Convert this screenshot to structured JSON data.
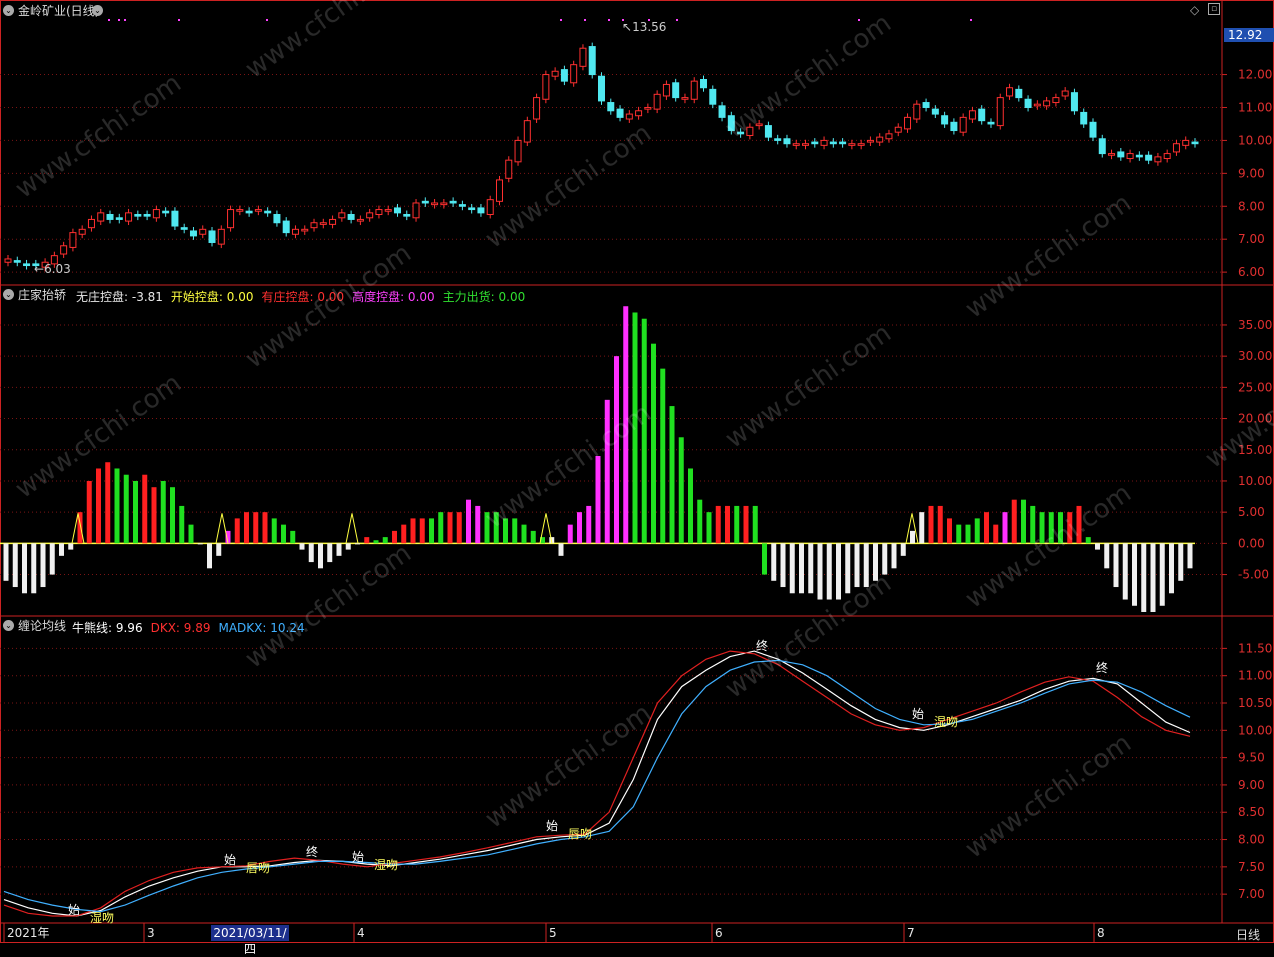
{
  "header": {
    "title": "金岭矿业(日线)",
    "current_price": "12.92"
  },
  "kline": {
    "high_label": "13.56",
    "low_label": "6.03",
    "axis": [
      "12.00",
      "11.00",
      "10.00",
      "9.00",
      "8.00",
      "7.00",
      "6.00"
    ],
    "axis_values": [
      12,
      11,
      10,
      9,
      8,
      7,
      6
    ]
  },
  "indicator1": {
    "name": "庄家抬轿",
    "items": [
      {
        "label": "无庄控盘: -3.81",
        "color": "#e8e8e8"
      },
      {
        "label": "开始控盘: 0.00",
        "color": "#ffff40"
      },
      {
        "label": "有庄控盘: 0.00",
        "color": "#ff3030"
      },
      {
        "label": "高度控盘: 0.00",
        "color": "#ff40ff"
      },
      {
        "label": "主力出货: 0.00",
        "color": "#30e030"
      }
    ],
    "axis": [
      "35.00",
      "30.00",
      "25.00",
      "20.00",
      "15.00",
      "10.00",
      "5.00",
      "0.00",
      "-5.00"
    ],
    "axis_values": [
      35,
      30,
      25,
      20,
      15,
      10,
      5,
      0,
      -5
    ]
  },
  "indicator2": {
    "name": "缠论均线",
    "items": [
      {
        "label": "牛熊线: 9.96",
        "color": "#ffffff"
      },
      {
        "label": "DKX: 9.89",
        "color": "#ff3030"
      },
      {
        "label": "MADKX: 10.24",
        "color": "#40b0ff"
      }
    ],
    "axis": [
      "11.50",
      "11.00",
      "10.50",
      "10.00",
      "9.50",
      "9.00",
      "8.50",
      "8.00",
      "7.50",
      "7.00"
    ],
    "axis_values": [
      11.5,
      11,
      10.5,
      10,
      9.5,
      9,
      8.5,
      8,
      7.5,
      7
    ],
    "markers": [
      {
        "t": "始",
        "sub": "湿吻"
      },
      {
        "t": "始",
        "sub": "唇吻"
      },
      {
        "t": "终",
        "sub": ""
      },
      {
        "t": "始",
        "sub": "湿吻"
      },
      {
        "t": "始",
        "sub": "唇吻"
      },
      {
        "t": "终",
        "sub": ""
      },
      {
        "t": "始",
        "sub": "湿吻"
      },
      {
        "t": "终",
        "sub": ""
      }
    ]
  },
  "time_axis": {
    "labels": [
      "2021年",
      "3",
      "4",
      "5",
      "6",
      "7",
      "8"
    ],
    "cursor_date": "2021/03/11/四",
    "period": "日线"
  },
  "watermark": "www.cfchi.com",
  "colors": {
    "up": "#ff3030",
    "down": "#50e8f0",
    "grid": "#7a1414",
    "axis": "#cc2222"
  },
  "chart_data": [
    {
      "type": "candlestick",
      "title": "金岭矿业(日线)",
      "ylim": [
        5.7,
        13.9
      ],
      "high": 13.56,
      "low": 6.03,
      "close": [
        6.4,
        6.3,
        6.2,
        6.2,
        6.3,
        6.5,
        6.8,
        7.2,
        7.3,
        7.6,
        7.8,
        7.6,
        7.6,
        7.8,
        7.7,
        7.7,
        7.9,
        7.8,
        7.4,
        7.3,
        7.1,
        7.3,
        6.9,
        7.3,
        7.9,
        7.9,
        7.8,
        7.9,
        7.8,
        7.5,
        7.2,
        7.3,
        7.3,
        7.5,
        7.5,
        7.6,
        7.8,
        7.6,
        7.6,
        7.8,
        7.9,
        7.9,
        7.8,
        7.7,
        8.1,
        8.1,
        8.1,
        8.1,
        8.1,
        8.0,
        7.9,
        7.8,
        8.2,
        8.8,
        9.4,
        10.0,
        10.6,
        11.3,
        12.0,
        12.1,
        11.8,
        12.3,
        12.8,
        12.0,
        11.2,
        10.9,
        10.7,
        10.8,
        10.9,
        11.0,
        11.4,
        11.7,
        11.3,
        11.3,
        11.8,
        11.6,
        11.1,
        10.7,
        10.3,
        10.2,
        10.4,
        10.5,
        10.1,
        10.0,
        9.9,
        9.9,
        9.9,
        9.9,
        10.0,
        9.9,
        9.9,
        9.9,
        9.9,
        10.0,
        10.1,
        10.2,
        10.4,
        10.7,
        11.1,
        11.0,
        10.8,
        10.5,
        10.3,
        10.7,
        10.9,
        10.6,
        10.5,
        11.3,
        11.6,
        11.3,
        11.0,
        11.1,
        11.2,
        11.3,
        11.5,
        10.9,
        10.5,
        10.1,
        9.6,
        9.6,
        9.5,
        9.6,
        9.5,
        9.4,
        9.5,
        9.6,
        9.9,
        10.0,
        9.9
      ]
    },
    {
      "type": "bar",
      "title": "庄家抬轿",
      "ylim": [
        -11,
        39
      ],
      "values": [
        -6,
        -7,
        -8,
        -8,
        -7,
        -5,
        -2,
        -1,
        5,
        10,
        12,
        13,
        12,
        11,
        10,
        11,
        9,
        10,
        9,
        6,
        3,
        0,
        -4,
        -2,
        2,
        4,
        5,
        5,
        5,
        4,
        3,
        2,
        -1,
        -3,
        -4,
        -3,
        -2,
        -1,
        0,
        1,
        0.5,
        1,
        2,
        3,
        4,
        4,
        4,
        5,
        5,
        5,
        7,
        6,
        5,
        5,
        4,
        4,
        3,
        2,
        1,
        1,
        -2,
        3,
        5,
        6,
        14,
        23,
        30,
        38,
        37,
        36,
        32,
        28,
        22,
        17,
        12,
        7,
        5,
        6,
        6,
        6,
        6,
        6,
        -5,
        -6,
        -7,
        -8,
        -8,
        -8,
        -9,
        -9,
        -9,
        -8,
        -7,
        -7,
        -6,
        -5,
        -4,
        -2,
        2,
        5,
        6,
        6,
        4,
        3,
        3,
        4,
        5,
        3,
        5,
        7,
        7,
        6,
        5,
        5,
        5,
        5,
        6,
        1,
        -1,
        -4,
        -7,
        -9,
        -10,
        -11,
        -11,
        -10,
        -8,
        -6,
        -4
      ],
      "colors": [
        "w",
        "w",
        "w",
        "w",
        "w",
        "w",
        "w",
        "w",
        "r",
        "r",
        "r",
        "r",
        "g",
        "g",
        "g",
        "r",
        "r",
        "g",
        "g",
        "g",
        "g",
        "w",
        "w",
        "w",
        "m",
        "r",
        "r",
        "r",
        "r",
        "g",
        "g",
        "g",
        "w",
        "w",
        "w",
        "w",
        "w",
        "w",
        "w",
        "r",
        "g",
        "g",
        "r",
        "r",
        "r",
        "r",
        "g",
        "g",
        "r",
        "r",
        "m",
        "m",
        "g",
        "g",
        "g",
        "g",
        "g",
        "g",
        "g",
        "w",
        "w",
        "m",
        "m",
        "m",
        "m",
        "m",
        "m",
        "m",
        "g",
        "g",
        "g",
        "g",
        "g",
        "g",
        "g",
        "g",
        "g",
        "r",
        "r",
        "g",
        "r",
        "g",
        "g",
        "w",
        "w",
        "w",
        "w",
        "w",
        "w",
        "w",
        "w",
        "w",
        "w",
        "w",
        "w",
        "w",
        "w",
        "w",
        "w",
        "w",
        "r",
        "r",
        "r",
        "g",
        "g",
        "g",
        "r",
        "r",
        "m",
        "r",
        "g",
        "g",
        "g",
        "g",
        "g",
        "r",
        "r",
        "g",
        "w",
        "w",
        "w",
        "w",
        "w",
        "w",
        "w",
        "w",
        "w",
        "w",
        "w"
      ]
    },
    {
      "type": "line",
      "title": "缠论均线",
      "ylim": [
        6.6,
        11.8
      ],
      "series": [
        {
          "name": "牛熊线",
          "values": [
            6.9,
            6.75,
            6.65,
            6.6,
            6.7,
            6.95,
            7.15,
            7.3,
            7.42,
            7.5,
            7.5,
            7.52,
            7.58,
            7.62,
            7.6,
            7.55,
            7.52,
            7.58,
            7.64,
            7.72,
            7.8,
            7.9,
            8.0,
            8.05,
            8.08,
            8.3,
            9.1,
            10.2,
            10.8,
            11.1,
            11.35,
            11.45,
            11.3,
            11.05,
            10.75,
            10.45,
            10.2,
            10.05,
            10.0,
            10.1,
            10.25,
            10.4,
            10.55,
            10.75,
            10.9,
            10.95,
            10.85,
            10.5,
            10.15,
            9.96
          ]
        },
        {
          "name": "DKX",
          "values": [
            6.8,
            6.65,
            6.6,
            6.6,
            6.75,
            7.05,
            7.25,
            7.4,
            7.48,
            7.5,
            7.52,
            7.6,
            7.66,
            7.62,
            7.55,
            7.5,
            7.56,
            7.62,
            7.68,
            7.76,
            7.85,
            7.95,
            8.05,
            8.08,
            8.1,
            8.5,
            9.5,
            10.5,
            11.0,
            11.3,
            11.45,
            11.4,
            11.2,
            10.9,
            10.6,
            10.3,
            10.1,
            10.0,
            10.05,
            10.2,
            10.35,
            10.5,
            10.7,
            10.88,
            10.98,
            10.9,
            10.6,
            10.25,
            10.0,
            9.89
          ]
        },
        {
          "name": "MADKX",
          "values": [
            7.05,
            6.9,
            6.8,
            6.72,
            6.68,
            6.8,
            6.98,
            7.15,
            7.3,
            7.4,
            7.46,
            7.5,
            7.55,
            7.6,
            7.6,
            7.58,
            7.55,
            7.55,
            7.6,
            7.66,
            7.72,
            7.82,
            7.92,
            8.0,
            8.05,
            8.15,
            8.6,
            9.5,
            10.3,
            10.8,
            11.1,
            11.25,
            11.28,
            11.2,
            11.0,
            10.7,
            10.4,
            10.2,
            10.1,
            10.12,
            10.2,
            10.35,
            10.5,
            10.68,
            10.85,
            10.92,
            10.88,
            10.7,
            10.45,
            10.24
          ]
        }
      ]
    }
  ]
}
